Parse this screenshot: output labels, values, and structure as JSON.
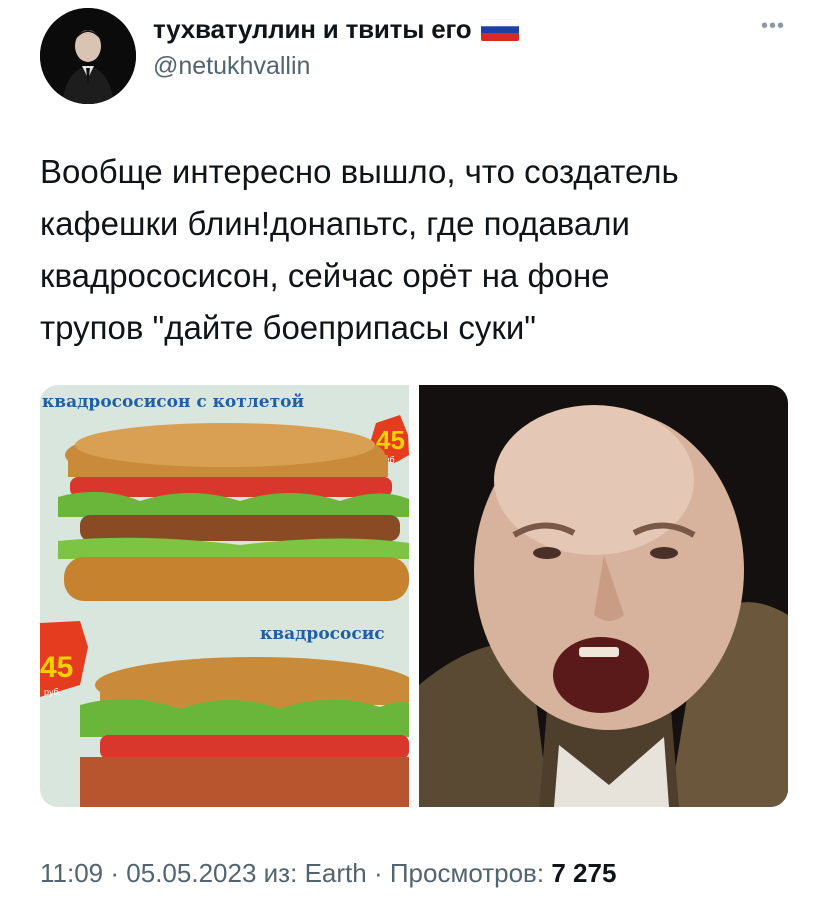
{
  "author": {
    "display_name": "тухватуллин и твиты его",
    "handle": "@netukhvallin",
    "avatar_icon": "avatar-portrait",
    "flag_icon": "russia-flag-icon"
  },
  "more_icon": "more-dots-icon",
  "tweet": {
    "text": "Вообще интересно вышло, что создатель\nкафешки блин!донапьтс, где подавали\nквадрососисон, сейчас орёт на фоне\nтрупов \"дайте боеприпасы суки\""
  },
  "media": {
    "image1": {
      "caption_top": "квадрососисон с котлетой",
      "caption_mid": "квадрососис",
      "price": "45",
      "currency": "руб."
    }
  },
  "meta": {
    "time": "11:09",
    "date": "05.05.2023",
    "source_prefix": "из:",
    "source": "Earth",
    "views_label": "Просмотров:",
    "views_count": "7 275",
    "separator": "·"
  },
  "colors": {
    "text": "#0f1419",
    "secondary": "#536471",
    "bun": "#c98a3a",
    "tomato": "#d9362c",
    "lettuce": "#6ab63a"
  }
}
